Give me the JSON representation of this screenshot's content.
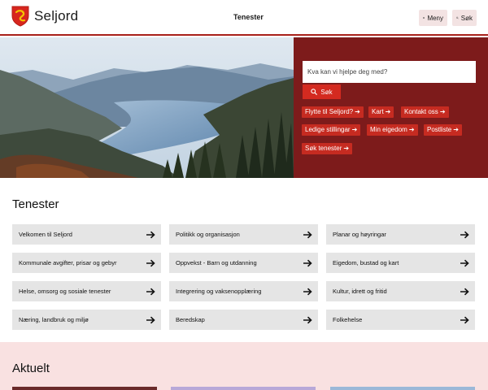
{
  "header": {
    "logo_text": "Seljord",
    "nav_link": "Tenester",
    "menu_label": "Meny",
    "search_label": "Søk"
  },
  "hero": {
    "search_placeholder": "Kva kan vi hjelpe deg med?",
    "search_button": "Søk",
    "quick_links": [
      "Flytte til Seljord?",
      "Kart",
      "Kontakt oss",
      "Ledige stillingar",
      "Min eigedom",
      "Postliste",
      "Søk tenester"
    ]
  },
  "tenester": {
    "title": "Tenester",
    "items": [
      "Velkomen til Seljord",
      "Politikk og organisasjon",
      "Planar og høyringar",
      "Kommunale avgifter, prisar og gebyr",
      "Oppvekst - Barn og utdanning",
      "Eigedom, bustad og kart",
      "Helse, omsorg og sosiale tenester",
      "Integrering og vaksenopplæring",
      "Kultur, idrett og fritid",
      "Næring, landbruk og miljø",
      "Beredskap",
      "Folkehelse"
    ]
  },
  "aktuelt": {
    "title": "Aktuelt"
  },
  "colors": {
    "accent": "#a8201a",
    "panel": "#7d1b1b",
    "button": "#d42a20",
    "tile": "#e5e5e5",
    "aktuelt_bg": "#f9e1e1"
  }
}
